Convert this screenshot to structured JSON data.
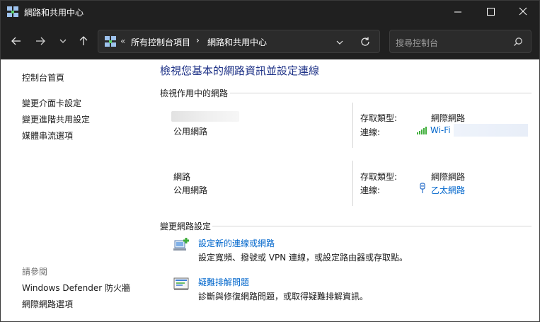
{
  "window": {
    "title": "網路和共用中心"
  },
  "address": {
    "separator": "«",
    "crumbs": [
      "所有控制台項目",
      "網路和共用中心"
    ],
    "crumb_separator": "›"
  },
  "search": {
    "placeholder": "搜尋控制台"
  },
  "sidebar": {
    "links": [
      "控制台首頁",
      "變更介面卡設定",
      "變更進階共用設定",
      "媒體串流選項"
    ],
    "see_also_title": "請參閱",
    "see_also_links": [
      "Windows Defender 防火牆",
      "網際網路選項"
    ]
  },
  "main": {
    "heading": "檢視您基本的網路資訊並設定連線",
    "active_networks_title": "檢視作用中的網路",
    "networks": [
      {
        "name": "",
        "type": "公用網路",
        "access_label": "存取類型:",
        "access_value": "網際網路",
        "conn_label": "連線:",
        "conn_value": "Wi-Fi",
        "conn_icon": "wifi-signal-icon"
      },
      {
        "name": "網路",
        "type": "公用網路",
        "access_label": "存取類型:",
        "access_value": "網際網路",
        "conn_label": "連線:",
        "conn_value": "乙太網路",
        "conn_icon": "ethernet-icon"
      }
    ],
    "change_settings_title": "變更網路設定",
    "tasks": [
      {
        "title": "設定新的連線或網路",
        "desc": "設定寬頻、撥號或 VPN 連線，或設定路由器或存取點。",
        "icon": "new-connection-icon"
      },
      {
        "title": "疑難排解問題",
        "desc": "診斷與修復網路問題，或取得疑難排解資訊。",
        "icon": "troubleshoot-icon"
      }
    ]
  },
  "colors": {
    "titlebar": "#202020",
    "heading": "#1e3287",
    "link": "#0066cc"
  }
}
